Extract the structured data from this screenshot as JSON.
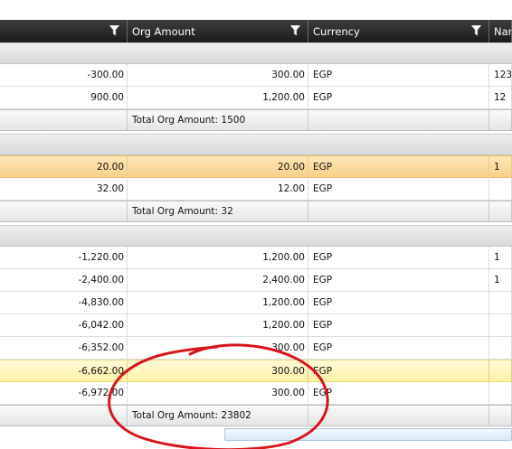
{
  "columns": {
    "col1": "",
    "col2": "Org Amount",
    "col3": "Currency",
    "col4": "Nar"
  },
  "icons": {
    "filter": "filter-funnel-icon"
  },
  "groups": [
    {
      "rows": [
        {
          "amount": "-300.00",
          "org_amount": "300.00",
          "currency": "EGP",
          "extra": "123"
        },
        {
          "amount": "900.00",
          "org_amount": "1,200.00",
          "currency": "EGP",
          "extra": "12"
        }
      ],
      "total": "Total Org Amount: 1500"
    },
    {
      "rows": [
        {
          "amount": "20.00",
          "org_amount": "20.00",
          "currency": "EGP",
          "extra": "1"
        },
        {
          "amount": "32.00",
          "org_amount": "12.00",
          "currency": "EGP",
          "extra": ""
        }
      ],
      "total": "Total Org Amount: 32"
    },
    {
      "rows": [
        {
          "amount": "-1,220.00",
          "org_amount": "1,200.00",
          "currency": "EGP",
          "extra": "1"
        },
        {
          "amount": "-2,400.00",
          "org_amount": "2,400.00",
          "currency": "EGP",
          "extra": "1"
        },
        {
          "amount": "-4,830.00",
          "org_amount": "1,200.00",
          "currency": "EGP",
          "extra": ""
        },
        {
          "amount": "-6,042.00",
          "org_amount": "1,200.00",
          "currency": "EGP",
          "extra": ""
        },
        {
          "amount": "-6,352.00",
          "org_amount": "300.00",
          "currency": "EGP",
          "extra": ""
        },
        {
          "amount": "-6,662.00",
          "org_amount": "300.00",
          "currency": "EGP",
          "extra": ""
        },
        {
          "amount": "-6,972.00",
          "org_amount": "300.00",
          "currency": "EGP",
          "extra": ""
        }
      ],
      "total": "Total Org Amount: 23802"
    }
  ],
  "colors": {
    "header_bg": "#2a2a2a",
    "selected_orange": "#fbd99a",
    "selected_yellow": "#fff4b8",
    "annotation_red": "#d8141c"
  }
}
